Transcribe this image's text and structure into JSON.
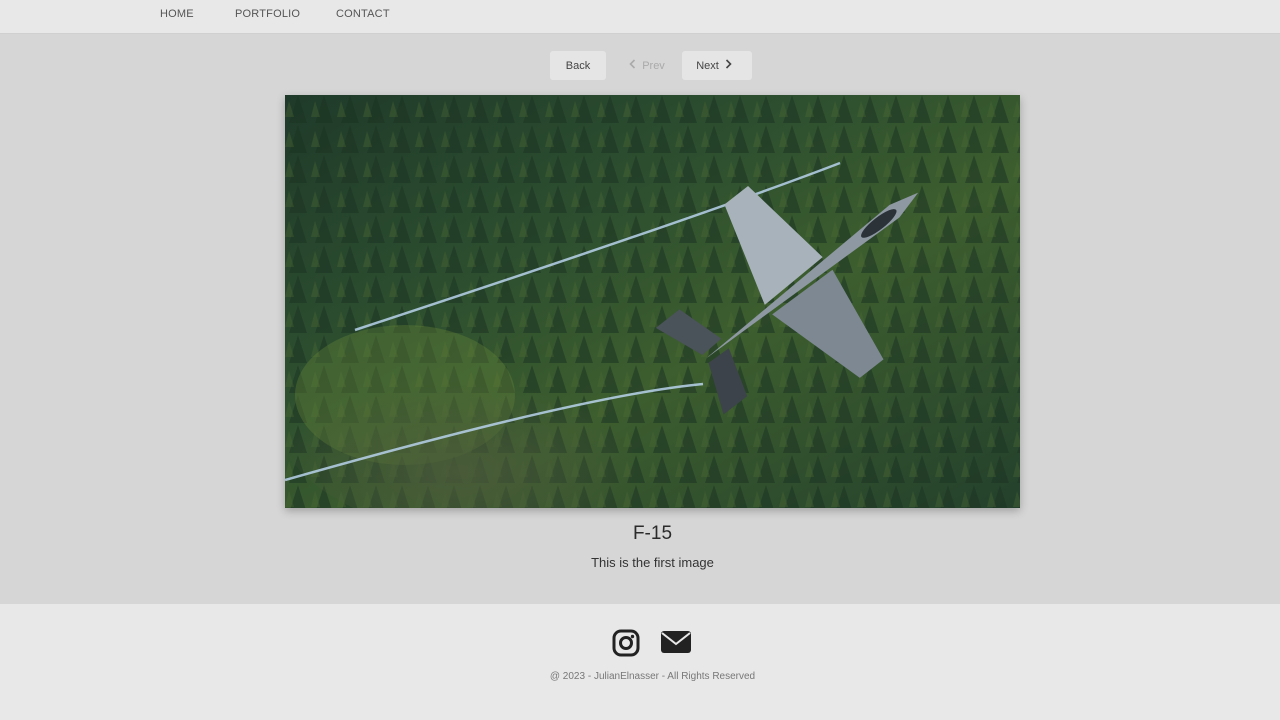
{
  "nav": {
    "home": "HOME",
    "portfolio": "PORTFOLIO",
    "contact": "CONTACT"
  },
  "pager": {
    "back": "Back",
    "prev": "Prev",
    "next": "Next"
  },
  "image": {
    "title": "F-15",
    "description": "This is the first image"
  },
  "footer": {
    "copyright": "@ 2023 - JulianElnasser - All Rights Reserved",
    "icons": [
      "instagram-icon",
      "email-icon"
    ]
  }
}
